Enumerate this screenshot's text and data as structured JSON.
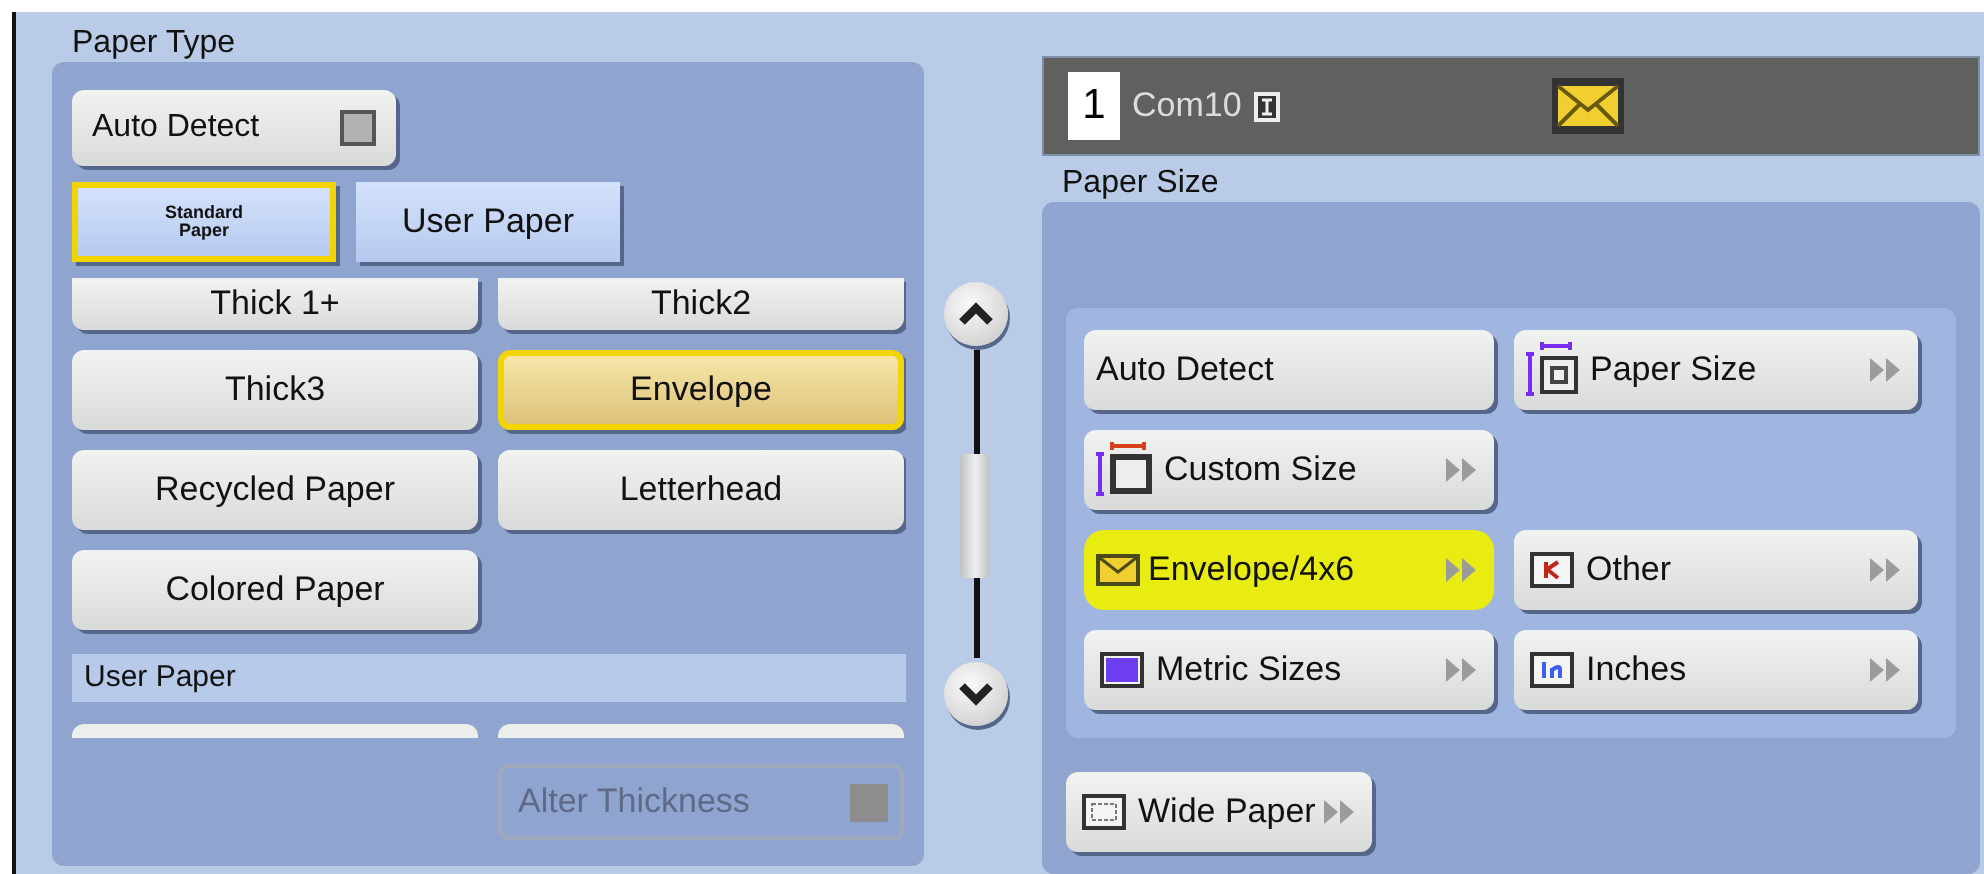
{
  "paper_type": {
    "title": "Paper Type",
    "auto_detect": {
      "label": "Auto Detect",
      "checked": false
    },
    "tabs": [
      {
        "label": "Standard Paper",
        "selected": true
      },
      {
        "label": "User Paper",
        "selected": false
      }
    ],
    "types": [
      {
        "label": "Thick 1+",
        "selected": false
      },
      {
        "label": "Thick2",
        "selected": false
      },
      {
        "label": "Thick3",
        "selected": false
      },
      {
        "label": "Envelope",
        "selected": true
      },
      {
        "label": "Recycled Paper",
        "selected": false
      },
      {
        "label": "Letterhead",
        "selected": false
      },
      {
        "label": "Colored Paper",
        "selected": false
      }
    ],
    "user_paper_header": "User Paper",
    "alter_thickness": {
      "label": "Alter Thickness",
      "disabled": true,
      "checked": false
    }
  },
  "tray": {
    "number": "1",
    "paper": "Com10"
  },
  "paper_size": {
    "title": "Paper Size",
    "options": [
      {
        "label": "Auto Detect",
        "kind": "plain",
        "submenu": false,
        "selected": false
      },
      {
        "label": "Paper Size",
        "kind": "paper-size",
        "submenu": true,
        "selected": false
      },
      {
        "label": "Custom Size",
        "kind": "custom",
        "submenu": true,
        "selected": false
      },
      {
        "kind": "empty"
      },
      {
        "label": "Envelope/4x6",
        "kind": "envelope",
        "submenu": true,
        "selected": true
      },
      {
        "label": "Other",
        "kind": "other",
        "submenu": true,
        "selected": false
      },
      {
        "label": "Metric Sizes",
        "kind": "metric",
        "submenu": true,
        "selected": false
      },
      {
        "label": "Inches",
        "kind": "inches",
        "submenu": true,
        "selected": false
      }
    ],
    "wide_paper": {
      "label": "Wide Paper",
      "kind": "wide",
      "submenu": true,
      "selected": false
    }
  }
}
